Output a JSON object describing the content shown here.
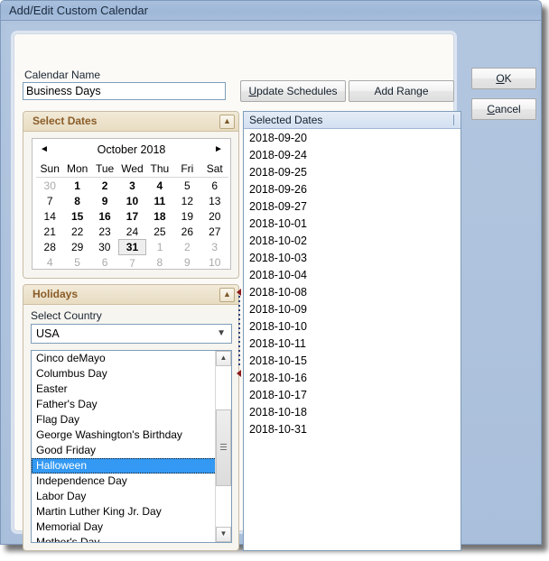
{
  "window": {
    "title": "Add/Edit Custom Calendar"
  },
  "form": {
    "calendar_name_label": "Calendar Name",
    "calendar_name_value": "Business Days",
    "calendar_name_placeholder": ""
  },
  "buttons": {
    "update_schedules": "Update Schedules",
    "update_schedules_accesskey": "U",
    "update_schedules_rest": "pdate Schedules",
    "add_range": "Add Range",
    "ok_accesskey": "O",
    "ok_rest": "K",
    "ok": "OK",
    "cancel_accesskey": "C",
    "cancel_rest": "ancel",
    "cancel": "Cancel"
  },
  "select_dates_group": {
    "title": "Select Dates",
    "collapse_icon": "chevron-up-icon",
    "calendar": {
      "month_label": "October 2018",
      "prev_icon": "◄",
      "next_icon": "►",
      "weekday_headers": [
        "Sun",
        "Mon",
        "Tue",
        "Wed",
        "Thu",
        "Fri",
        "Sat"
      ],
      "weeks": [
        [
          {
            "d": "30",
            "state": "other"
          },
          {
            "d": "1",
            "state": "selected"
          },
          {
            "d": "2",
            "state": "selected"
          },
          {
            "d": "3",
            "state": "selected"
          },
          {
            "d": "4",
            "state": "selected"
          },
          {
            "d": "5",
            "state": "normal"
          },
          {
            "d": "6",
            "state": "normal"
          }
        ],
        [
          {
            "d": "7",
            "state": "normal"
          },
          {
            "d": "8",
            "state": "selected"
          },
          {
            "d": "9",
            "state": "selected"
          },
          {
            "d": "10",
            "state": "selected"
          },
          {
            "d": "11",
            "state": "selected"
          },
          {
            "d": "12",
            "state": "normal"
          },
          {
            "d": "13",
            "state": "normal"
          }
        ],
        [
          {
            "d": "14",
            "state": "normal"
          },
          {
            "d": "15",
            "state": "selected"
          },
          {
            "d": "16",
            "state": "selected"
          },
          {
            "d": "17",
            "state": "selected"
          },
          {
            "d": "18",
            "state": "selected"
          },
          {
            "d": "19",
            "state": "normal"
          },
          {
            "d": "20",
            "state": "normal"
          }
        ],
        [
          {
            "d": "21",
            "state": "normal"
          },
          {
            "d": "22",
            "state": "normal"
          },
          {
            "d": "23",
            "state": "normal"
          },
          {
            "d": "24",
            "state": "normal"
          },
          {
            "d": "25",
            "state": "normal"
          },
          {
            "d": "26",
            "state": "normal"
          },
          {
            "d": "27",
            "state": "normal"
          }
        ],
        [
          {
            "d": "28",
            "state": "normal"
          },
          {
            "d": "29",
            "state": "normal"
          },
          {
            "d": "30",
            "state": "normal"
          },
          {
            "d": "31",
            "state": "today"
          },
          {
            "d": "1",
            "state": "other"
          },
          {
            "d": "2",
            "state": "other"
          },
          {
            "d": "3",
            "state": "other"
          }
        ],
        [
          {
            "d": "4",
            "state": "other"
          },
          {
            "d": "5",
            "state": "other"
          },
          {
            "d": "6",
            "state": "other"
          },
          {
            "d": "7",
            "state": "other"
          },
          {
            "d": "8",
            "state": "other"
          },
          {
            "d": "9",
            "state": "other"
          },
          {
            "d": "10",
            "state": "other"
          }
        ]
      ]
    }
  },
  "holidays_group": {
    "title": "Holidays",
    "collapse_icon": "chevron-up-icon",
    "country_label": "Select Country",
    "country_value": "USA",
    "country_arrow_icon": "chevron-down-icon",
    "scrollbar": {
      "up_icon": "▲",
      "down_icon": "▼"
    },
    "items": [
      {
        "label": "Cinco deMayo",
        "selected": false
      },
      {
        "label": "Columbus Day",
        "selected": false
      },
      {
        "label": "Easter",
        "selected": false
      },
      {
        "label": "Father's Day",
        "selected": false
      },
      {
        "label": "Flag Day",
        "selected": false
      },
      {
        "label": "George Washington's Birthday",
        "selected": false
      },
      {
        "label": "Good Friday",
        "selected": false
      },
      {
        "label": "Halloween",
        "selected": true
      },
      {
        "label": "Independence Day",
        "selected": false
      },
      {
        "label": "Labor Day",
        "selected": false
      },
      {
        "label": "Martin Luther King Jr. Day",
        "selected": false
      },
      {
        "label": "Memorial Day",
        "selected": false
      },
      {
        "label": "Mother's Day",
        "selected": false
      }
    ]
  },
  "selected_dates": {
    "header": "Selected Dates",
    "items": [
      "2018-09-20",
      "2018-09-24",
      "2018-09-25",
      "2018-09-26",
      "2018-09-27",
      "2018-10-01",
      "2018-10-02",
      "2018-10-03",
      "2018-10-04",
      "2018-10-08",
      "2018-10-09",
      "2018-10-10",
      "2018-10-11",
      "2018-10-15",
      "2018-10-16",
      "2018-10-17",
      "2018-10-18",
      "2018-10-31"
    ]
  },
  "colors": {
    "titlebar": "#a9c0dd",
    "client_bg": "#b0c4de",
    "group_header": "#e8dcc2",
    "group_title_text": "#8a5c28",
    "selection_blue": "#3399f3",
    "list_header": "#d3e0f1"
  }
}
